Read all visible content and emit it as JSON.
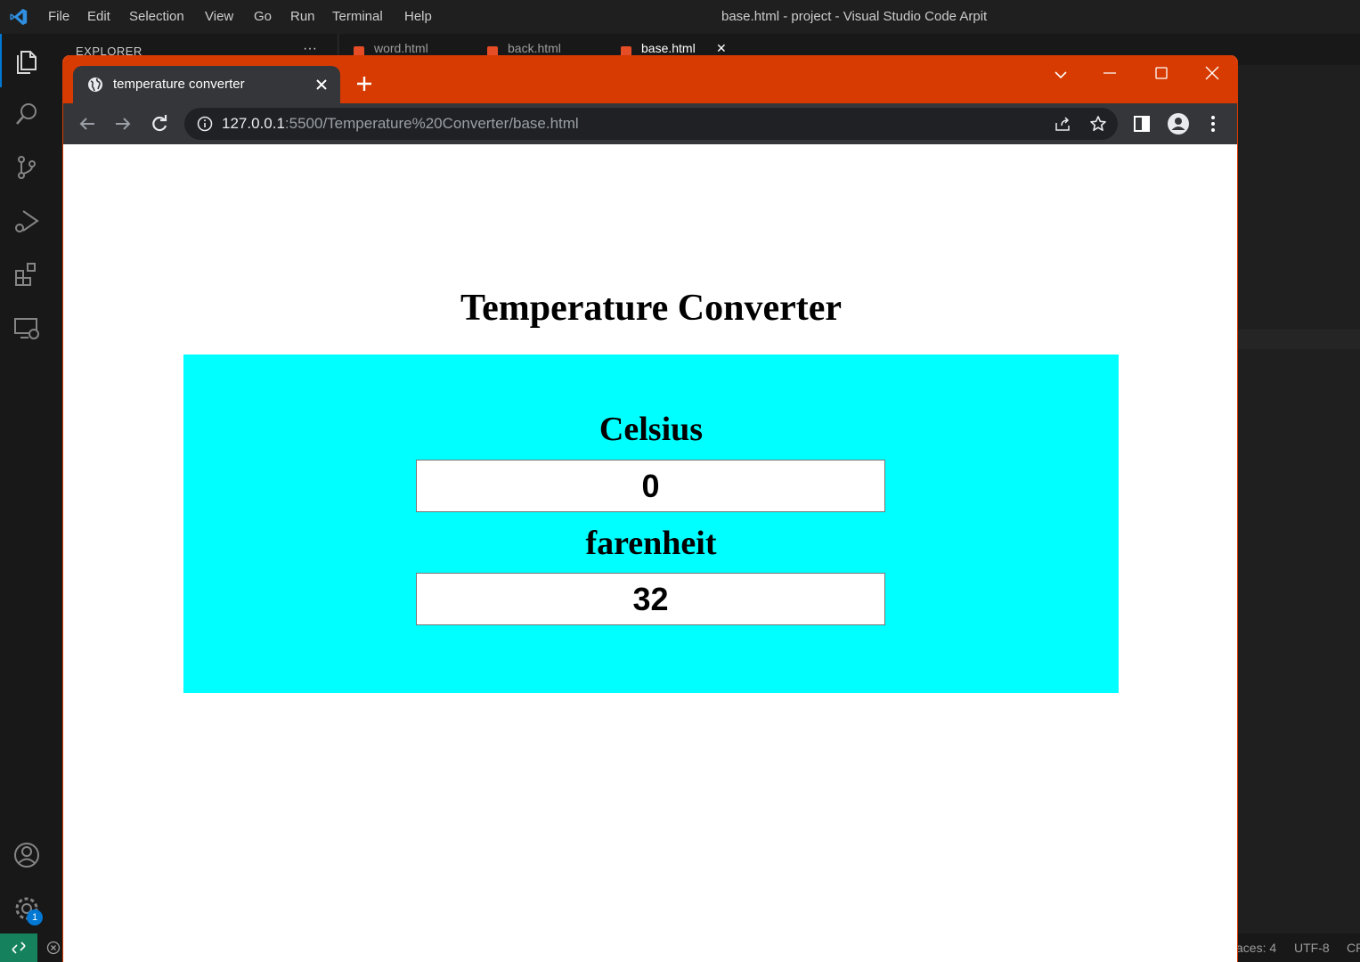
{
  "vscode": {
    "menu": [
      "File",
      "Edit",
      "Selection",
      "View",
      "Go",
      "Run",
      "Terminal",
      "Help"
    ],
    "window_title": "base.html - project - Visual Studio Code Arpit",
    "explorer_title": "EXPLORER",
    "explorer_more": "···",
    "editor_tabs": [
      "word.html",
      "back.html",
      "base.html"
    ],
    "active_tab_close": "✕",
    "accounts_badge": "1",
    "status": {
      "spaces": "aces: 4",
      "encoding": "UTF-8",
      "eol": "CR"
    }
  },
  "browser": {
    "tab_title": "temperature converter",
    "url_host": "127.0.0.1",
    "url_rest": ":5500/Temperature%20Converter/base.html",
    "accent_color": "#d83b01"
  },
  "page": {
    "heading": "Temperature Converter",
    "celsius_label": "Celsius",
    "celsius_value": "0",
    "fahrenheit_label": "farenheit",
    "fahrenheit_value": "32",
    "box_color": "#00ffff"
  }
}
